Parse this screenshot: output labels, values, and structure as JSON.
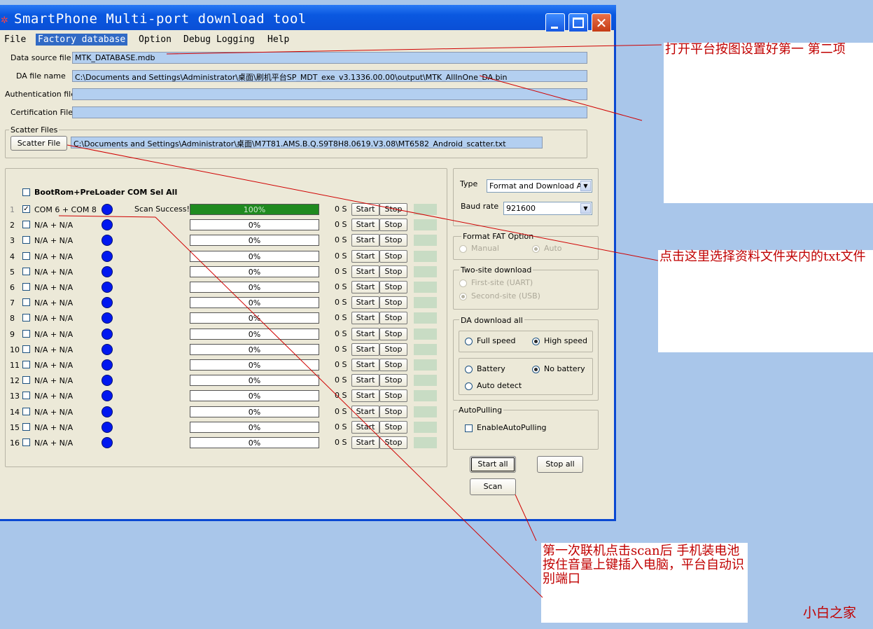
{
  "window": {
    "title": "SmartPhone Multi-port download tool"
  },
  "menu": [
    "File",
    "Factory database",
    "Option",
    "Debug Logging",
    "Help"
  ],
  "fields": [
    {
      "label": "Data source file",
      "value": "MTK_DATABASE.mdb"
    },
    {
      "label": "DA file name",
      "value": "C:\\Documents and Settings\\Administrator\\桌面\\刷机平台SP_MDT_exe_v3.1336.00.00\\output\\MTK_AllInOne_DA.bin"
    },
    {
      "label": "Authentication file",
      "value": ""
    },
    {
      "label": "Certification File",
      "value": ""
    }
  ],
  "scatter": {
    "group_label": "Scatter Files",
    "button_label": "Scatter File",
    "value": "C:\\Documents and Settings\\Administrator\\桌面\\M7T81.AMS.B.Q.S9T8H8.0619.V3.08\\MT6582_Android_scatter.txt"
  },
  "ports": {
    "select_all_label": "BootRom+PreLoader COM Sel All",
    "start_label": "Start",
    "stop_label": "Stop",
    "rows": [
      {
        "num": "1",
        "port": "COM 6 + COM 8",
        "status": "Scan Success!",
        "progress": 1.0,
        "progress_text": "100%",
        "time": "0 S",
        "checked": true
      },
      {
        "num": "2",
        "port": "N/A + N/A",
        "status": "",
        "progress": 0,
        "progress_text": "0%",
        "time": "0 S",
        "checked": false
      },
      {
        "num": "3",
        "port": "N/A + N/A",
        "status": "",
        "progress": 0,
        "progress_text": "0%",
        "time": "0 S",
        "checked": false
      },
      {
        "num": "4",
        "port": "N/A + N/A",
        "status": "",
        "progress": 0,
        "progress_text": "0%",
        "time": "0 S",
        "checked": false
      },
      {
        "num": "5",
        "port": "N/A + N/A",
        "status": "",
        "progress": 0,
        "progress_text": "0%",
        "time": "0 S",
        "checked": false
      },
      {
        "num": "6",
        "port": "N/A + N/A",
        "status": "",
        "progress": 0,
        "progress_text": "0%",
        "time": "0 S",
        "checked": false
      },
      {
        "num": "7",
        "port": "N/A + N/A",
        "status": "",
        "progress": 0,
        "progress_text": "0%",
        "time": "0 S",
        "checked": false
      },
      {
        "num": "8",
        "port": "N/A + N/A",
        "status": "",
        "progress": 0,
        "progress_text": "0%",
        "time": "0 S",
        "checked": false
      },
      {
        "num": "9",
        "port": "N/A + N/A",
        "status": "",
        "progress": 0,
        "progress_text": "0%",
        "time": "0 S",
        "checked": false
      },
      {
        "num": "10",
        "port": "N/A + N/A",
        "status": "",
        "progress": 0,
        "progress_text": "0%",
        "time": "0 S",
        "checked": false
      },
      {
        "num": "11",
        "port": "N/A + N/A",
        "status": "",
        "progress": 0,
        "progress_text": "0%",
        "time": "0 S",
        "checked": false
      },
      {
        "num": "12",
        "port": "N/A + N/A",
        "status": "",
        "progress": 0,
        "progress_text": "0%",
        "time": "0 S",
        "checked": false
      },
      {
        "num": "13",
        "port": "N/A + N/A",
        "status": "",
        "progress": 0,
        "progress_text": "0%",
        "time": "0 S",
        "checked": false
      },
      {
        "num": "14",
        "port": "N/A + N/A",
        "status": "",
        "progress": 0,
        "progress_text": "0%",
        "time": "0 S",
        "checked": false
      },
      {
        "num": "15",
        "port": "N/A + N/A",
        "status": "",
        "progress": 0,
        "progress_text": "0%",
        "time": "0 S",
        "checked": false
      },
      {
        "num": "16",
        "port": "N/A + N/A",
        "status": "",
        "progress": 0,
        "progress_text": "0%",
        "time": "0 S",
        "checked": false
      }
    ]
  },
  "settings": {
    "type_label": "Type",
    "type_value": "Format and Download All",
    "baud_label": "Baud rate",
    "baud_value": "921600",
    "format_fat": {
      "title": "Format FAT Option",
      "manual": "Manual",
      "auto": "Auto"
    },
    "two_site": {
      "title": "Two-site download",
      "first": "First-site (UART)",
      "second": "Second-site (USB)"
    },
    "da_download": {
      "title": "DA download all",
      "full_speed": "Full speed",
      "high_speed": "High speed",
      "battery": "Battery",
      "no_battery": "No battery",
      "auto_detect": "Auto detect"
    },
    "auto_pulling": {
      "title": "AutoPulling",
      "enable": "EnableAutoPulling"
    },
    "start_all": "Start all",
    "stop_all": "Stop all",
    "scan": "Scan"
  },
  "annotations": {
    "note1": "打开平台按图设置好第一 第二项",
    "note2": "点击这里选择资料文件夹内的txt文件",
    "note3": "第一次联机点击scan后 手机装电池按住音量上键插入电脑，平台自动识别端口",
    "watermark": "小白之家"
  },
  "colors": {
    "accent": "#0a58e0",
    "annotation": "#c00000",
    "progress": "#1f8a1f",
    "port_dot": "#0018f0"
  }
}
